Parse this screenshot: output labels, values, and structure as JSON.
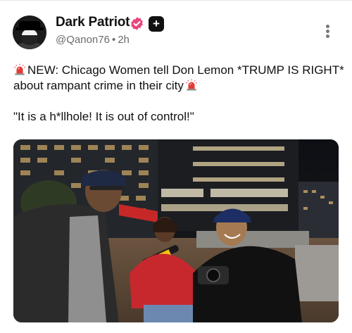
{
  "author": {
    "name": "Dark Patriot",
    "handle": "@Qanon76",
    "separator": "•",
    "time": "2h",
    "plus_badge": "+"
  },
  "post": {
    "line1_emoji_left": "siren-icon",
    "line1": "NEW: Chicago Women tell Don Lemon *TRUMP IS RIGHT* about rampant crime in their city",
    "line1_emoji_right": "siren-icon",
    "line2": "\"It is a h*llhole! It is out of control!\""
  },
  "media": {
    "type": "video-still",
    "scene": "night street interview"
  },
  "colors": {
    "verified": "#e8457a",
    "siren": "#e53935",
    "handle": "#6b6b6b"
  }
}
